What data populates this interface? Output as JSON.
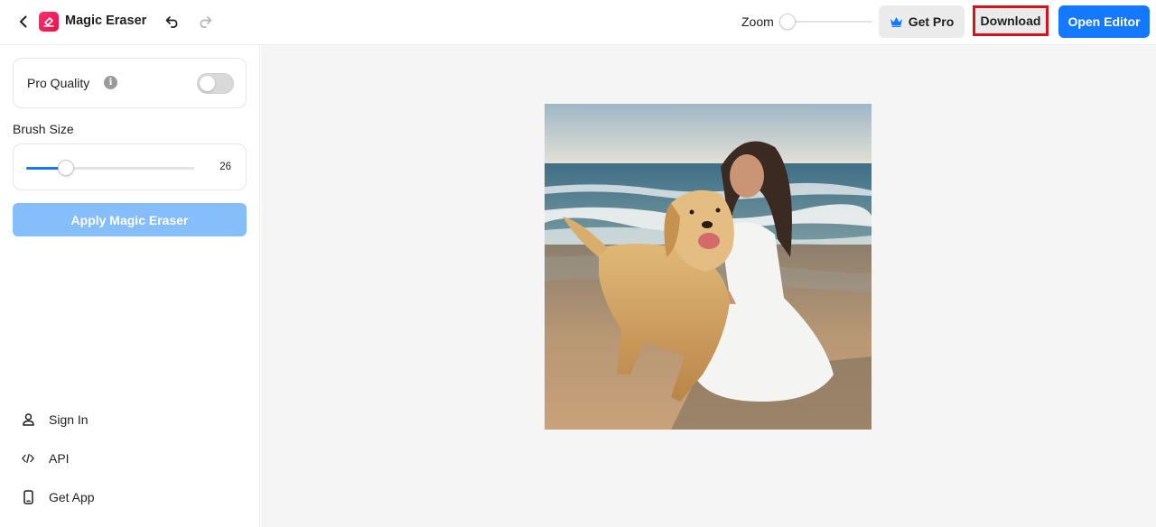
{
  "header": {
    "app_title": "Magic Eraser",
    "zoom_label": "Zoom",
    "zoom_level": 0,
    "get_pro_label": "Get Pro",
    "download_label": "Download",
    "open_editor_label": "Open Editor"
  },
  "sidebar": {
    "pro_quality_label": "Pro Quality",
    "pro_quality_enabled": false,
    "info_glyph": "i",
    "brush_size_label": "Brush Size",
    "brush_size_value": "26",
    "brush_size_fraction": 0.21,
    "apply_label": "Apply Magic Eraser",
    "links": [
      {
        "label": "Sign In",
        "icon": "user-icon"
      },
      {
        "label": "API",
        "icon": "code-icon"
      },
      {
        "label": "Get App",
        "icon": "phone-icon"
      }
    ]
  },
  "colors": {
    "accent": "#1479ff",
    "apply_disabled": "#86bdfb",
    "brand": "#e8124f",
    "highlight": "#d4141c"
  }
}
